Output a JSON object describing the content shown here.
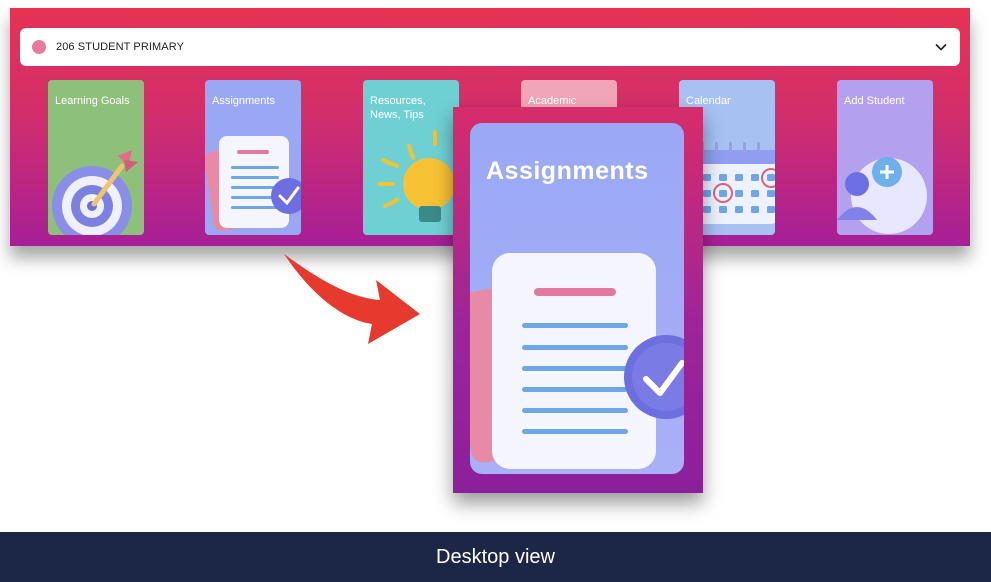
{
  "student_selector": {
    "label": "206 STUDENT PRIMARY",
    "dot_color": "#e87aa0",
    "icon": "chevron-down-icon"
  },
  "cards": [
    {
      "label": "Learning Goals",
      "color": "#8dc07a",
      "icon": "target-icon"
    },
    {
      "label": "Assignments",
      "color": "#9aa8f3",
      "icon": "document-check-icon"
    },
    {
      "label": "Resources, News, Tips",
      "color": "#6fd0d4",
      "icon": "lightbulb-icon"
    },
    {
      "label": "Academic",
      "color": "#f1a6b8",
      "icon": "academic-icon"
    },
    {
      "label": "Calendar",
      "color": "#a7c1f3",
      "icon": "calendar-icon"
    },
    {
      "label": "Add Student",
      "color": "#b3a1f0",
      "icon": "add-user-icon"
    }
  ],
  "zoomed_card": {
    "label": "Assignments",
    "icon": "document-check-icon"
  },
  "callout": {
    "icon": "curved-arrow-icon",
    "color": "#e63a2e"
  },
  "footer": {
    "caption": "Desktop view"
  }
}
